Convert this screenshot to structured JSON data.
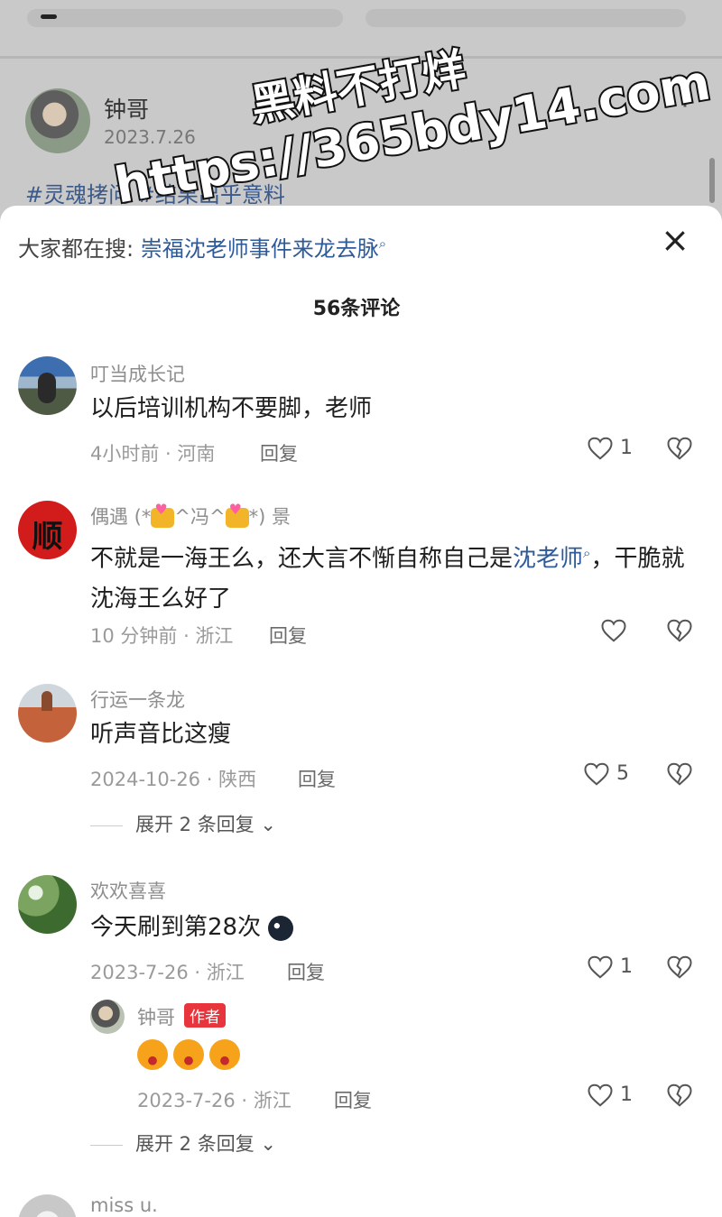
{
  "background": {
    "author_name": "钟哥",
    "post_date": "2023.7.26",
    "hashtags": "#灵魂拷问 #结果出乎意料"
  },
  "watermark": {
    "line1": "黑料不打烊",
    "line2": "https://365bdy14.com"
  },
  "sheet": {
    "search_label": "大家都在搜:",
    "search_query": "崇福沈老师事件来龙去脉",
    "search_icon": "search-icon",
    "close_icon": "close-icon",
    "comment_count": "56条评论"
  },
  "comments": [
    {
      "user": "叮当成长记",
      "text": "以后培训机构不要脚，老师",
      "meta": "4小时前 · 河南",
      "reply": "回复",
      "likes": "1"
    },
    {
      "user_prefix": "偶遇 (*",
      "user_mid": "^冯^",
      "user_suffix": "*) 景",
      "text_before": "不就是一海王么，还大言不惭自称自己是",
      "text_link": "沈老师",
      "text_after": "，干脆就沈海王么好了",
      "meta": "10 分钟前 · 浙江",
      "reply": "回复",
      "avatar_glyph": "顺",
      "likes": ""
    },
    {
      "user": "行运一条龙",
      "text": "听声音比这瘦",
      "meta": "2024-10-26 · 陕西",
      "reply": "回复",
      "likes": "5",
      "expand": "展开 2 条回复"
    },
    {
      "user": "欢欢喜喜",
      "text": "今天刷到第28次",
      "meta": "2023-7-26 · 浙江",
      "reply": "回复",
      "likes": "1",
      "sub_reply": {
        "user": "钟哥",
        "badge": "作者",
        "meta": "2023-7-26 · 浙江",
        "reply": "回复",
        "likes": "1"
      },
      "expand": "展开 2 条回复"
    },
    {
      "user": "miss u."
    }
  ]
}
